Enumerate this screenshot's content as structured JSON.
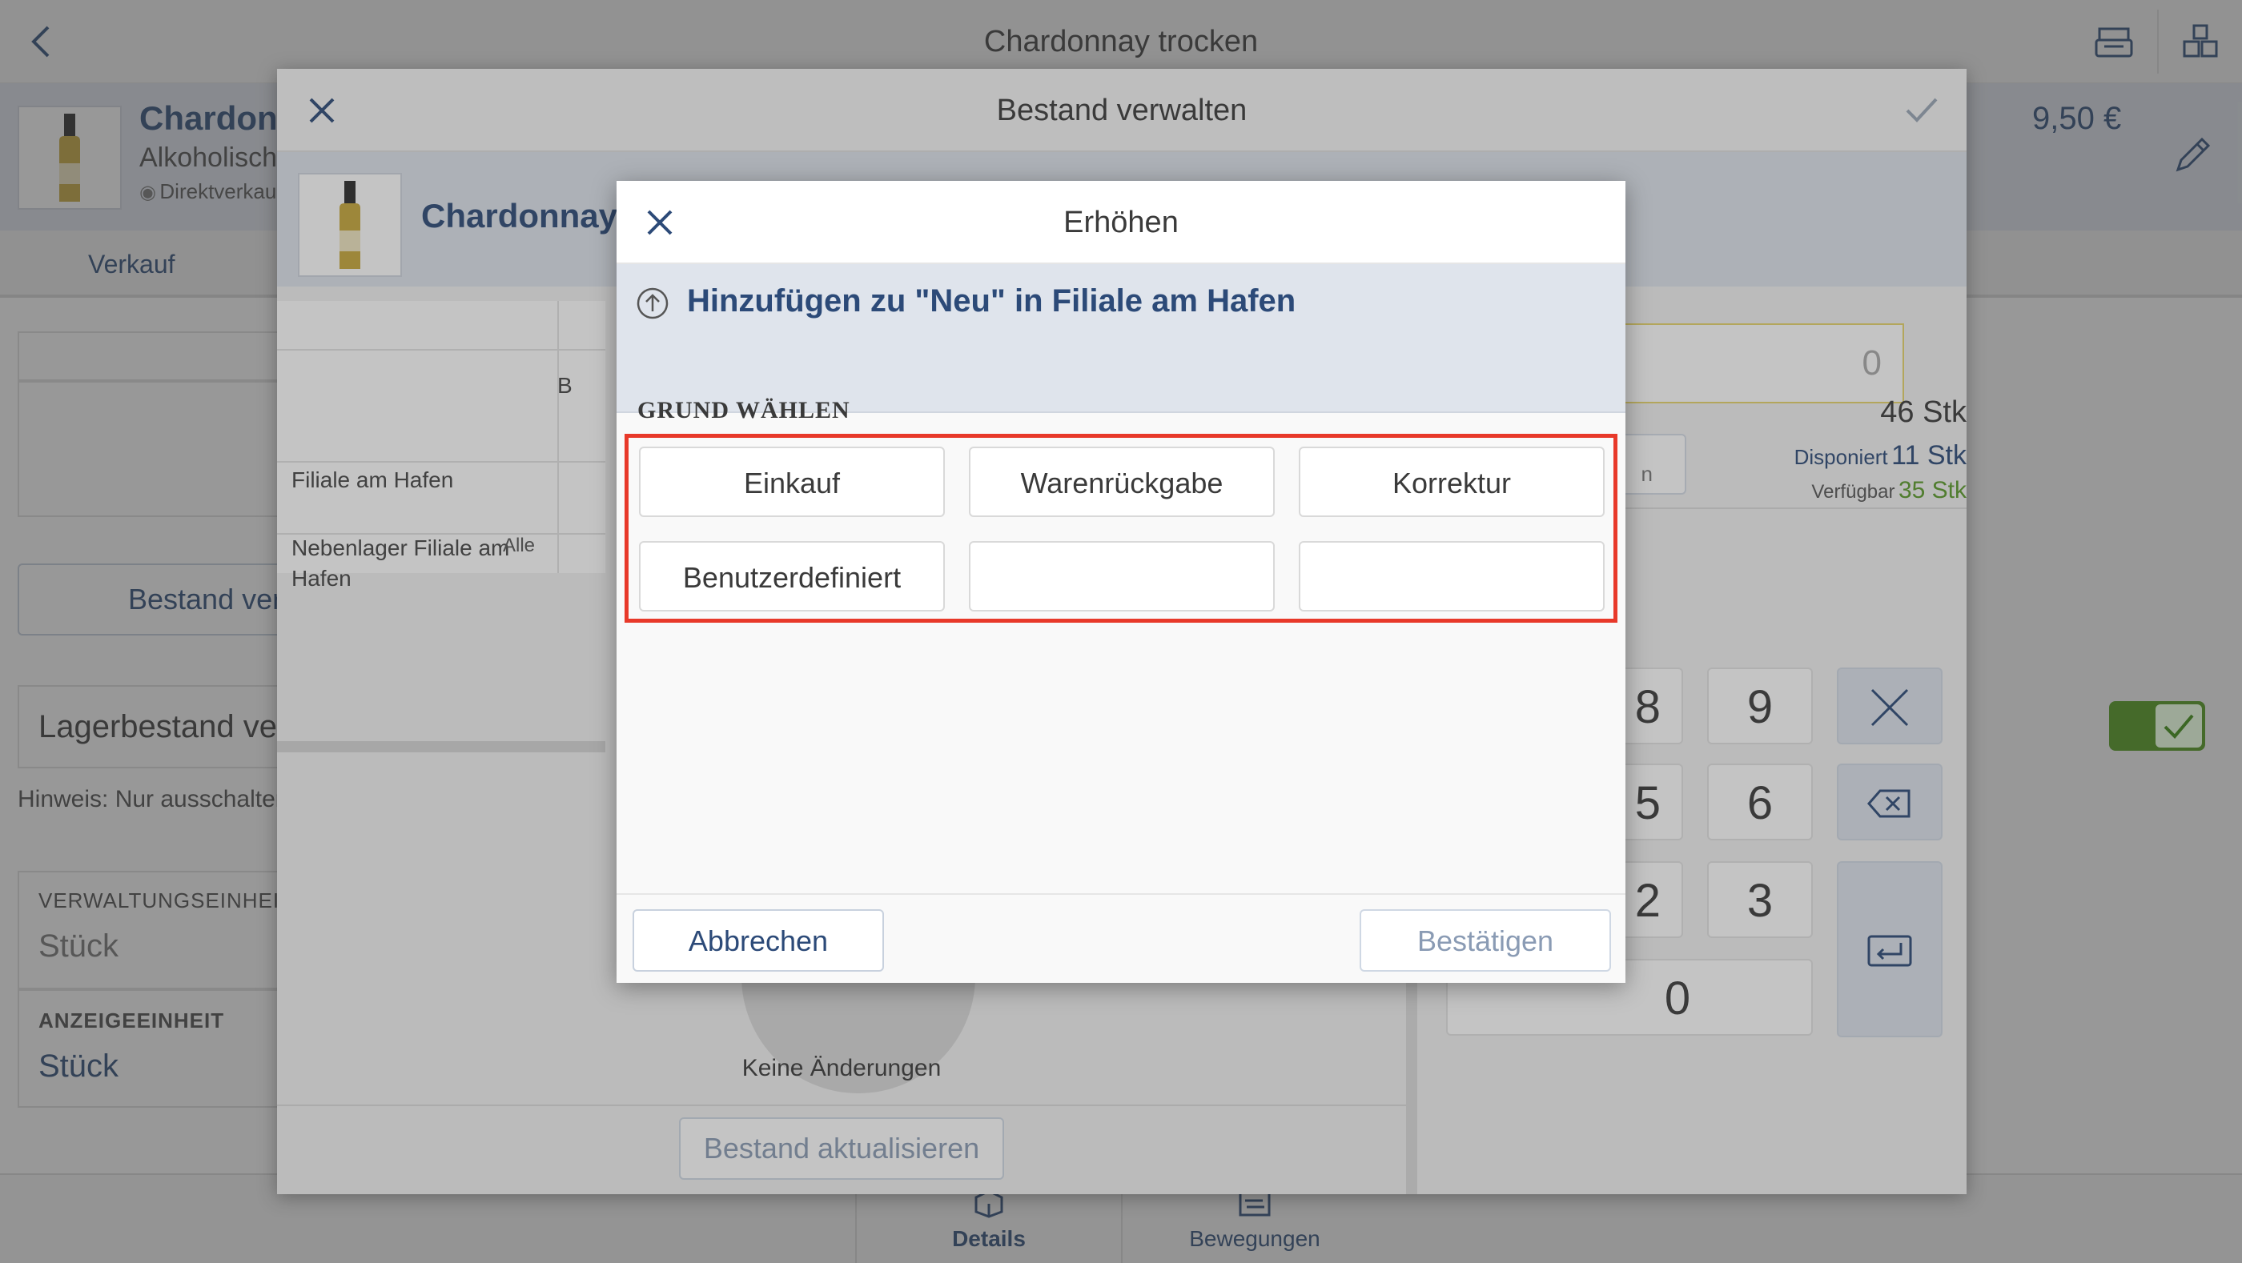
{
  "topbar": {
    "title": "Chardonnay trocken",
    "icons": [
      "back-icon",
      "cash-register-icon",
      "boxes-icon"
    ]
  },
  "product": {
    "name_truncated": "Chardonna",
    "category": "Alkoholisch",
    "sale_type_truncated": "Direktverkau",
    "price": "9,50 €"
  },
  "tabs": {
    "sale": "Verkauf"
  },
  "left_panel": {
    "manage_button_truncated": "Bestand verw",
    "inventory_toggle_truncated": "Lagerbestand ver",
    "hint_truncated": "Hinweis: Nur ausschalten",
    "unit_label": "VERWALTUNGSEINHEIT",
    "unit_value": "Stück",
    "display_unit_label": "ANZEIGEEINHEIT",
    "display_unit_value": "Stück"
  },
  "bottom_nav": {
    "details": "Details",
    "movements": "Bewegungen"
  },
  "stock_dialog": {
    "title": "Bestand verwalten",
    "product_name_truncated": "Chardonnay tr",
    "table": {
      "header_partial": "B",
      "rows": [
        "Filiale am Hafen",
        "Nebenlager Filiale am Hafen"
      ],
      "all_label": "Alle"
    },
    "quantity_value": "0",
    "stock_total": "46 Stk",
    "disposed_label": "Disponiert",
    "disposed_value": "11 Stk",
    "available_label": "Verfügbar",
    "available_value": "35 Stk",
    "partial_button_text": "n",
    "keypad": [
      "8",
      "9",
      "5",
      "6",
      "2",
      "3",
      "0"
    ],
    "no_changes": "Keine Änderungen",
    "update_button": "Bestand aktualisieren"
  },
  "increase_dialog": {
    "title": "Erhöhen",
    "info_text": "Hinzufügen zu \"Neu\" in Filiale am Hafen",
    "section_label": "GRUND WÄHLEN",
    "reasons": [
      "Einkauf",
      "Warenrückgabe",
      "Korrektur",
      "Benutzerdefiniert",
      "",
      ""
    ],
    "cancel_label": "Abbrechen",
    "confirm_label": "Bestätigen"
  },
  "colors": {
    "accent_blue": "#2c4a78",
    "highlight_red": "#e8392a",
    "toggle_green": "#5a9a2a",
    "available_green": "#5a9a2a"
  }
}
